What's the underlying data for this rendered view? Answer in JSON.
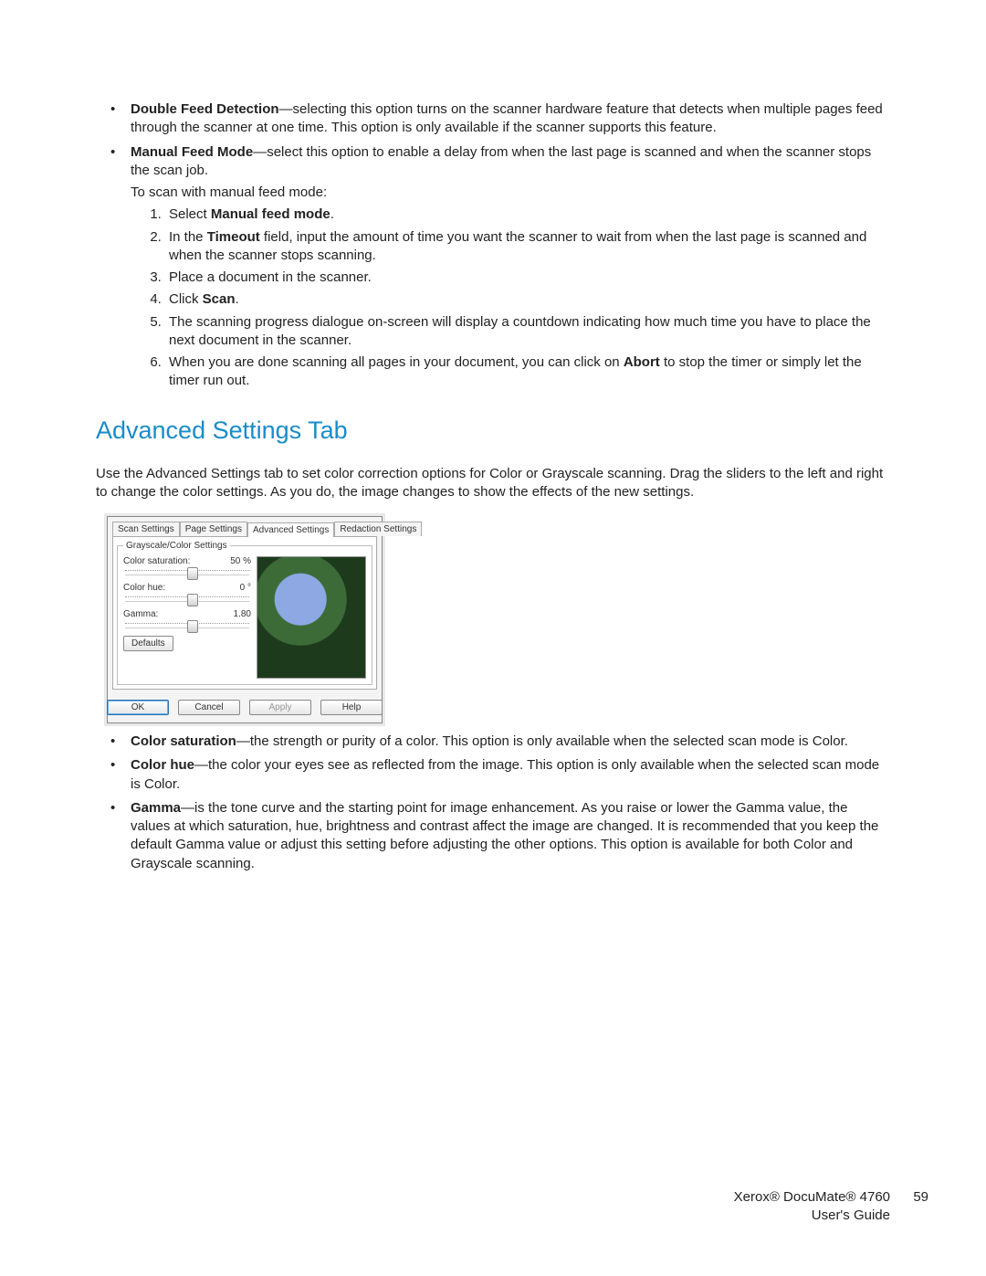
{
  "bullets1": [
    {
      "term": "Double Feed Detection",
      "body": "—selecting this option turns on the scanner hardware feature that detects when multiple pages feed through the scanner at one time. This option is only available if the scanner supports this feature."
    }
  ],
  "mfm": {
    "term": "Manual Feed Mode",
    "body": "—select this option to enable a delay from when the last page is scanned and when the scanner stops the scan job.",
    "sub": "To scan with manual feed mode:",
    "steps": {
      "s1a": "Select ",
      "s1b": "Manual feed mode",
      "s1c": ".",
      "s2a": "In the ",
      "s2b": "Timeout",
      "s2c": " field, input the amount of time you want the scanner to wait from when the last page is scanned and when the scanner stops scanning.",
      "s3": "Place a document in the scanner.",
      "s4a": "Click ",
      "s4b": "Scan",
      "s4c": ".",
      "s5": "The scanning progress dialogue on-screen will display a countdown indicating how much time you have to place the next document in the scanner.",
      "s6a": "When you are done scanning all pages in your document, you can click on ",
      "s6b": "Abort",
      "s6c": " to stop the timer or simply let the timer run out."
    }
  },
  "heading": "Advanced Settings Tab",
  "lead": {
    "a": "Use the Advanced Settings tab to set color correction options for Color or Grayscale scanning. ",
    "b": "Drag the sliders to the left and right to change the color settings. As you do, the image changes to show the effects of the new settings."
  },
  "dlg": {
    "tabs": [
      "Scan Settings",
      "Page Settings",
      "Advanced Settings",
      "Redaction Settings"
    ],
    "group": "Grayscale/Color Settings",
    "rows": [
      {
        "label": "Color saturation:",
        "value": "50 %",
        "pos": 50
      },
      {
        "label": "Color hue:",
        "value": "0 °",
        "pos": 50
      },
      {
        "label": "Gamma:",
        "value": "1.80",
        "pos": 50
      }
    ],
    "defaults": "Defaults",
    "buttons": [
      "OK",
      "Cancel",
      "Apply",
      "Help"
    ]
  },
  "bullets2": [
    {
      "term": "Color saturation",
      "body": "—the strength or purity of a color. This option is only available when the selected scan mode is Color."
    },
    {
      "term": "Color hue",
      "body": "—the color your eyes see as reflected from the image. This option is only available when the selected scan mode is Color."
    },
    {
      "term": "Gamma",
      "body": "—is the tone curve and the starting point for image enhancement. As you raise or lower the Gamma value, the values at which saturation, hue, brightness and contrast affect the image are changed. It is recommended that you keep the default Gamma value or adjust this setting before adjusting the other options. This option is available for both Color and Grayscale scanning."
    }
  ],
  "footer": {
    "line1": "Xerox® DocuMate® 4760",
    "line2": "User's Guide",
    "page": "59"
  }
}
